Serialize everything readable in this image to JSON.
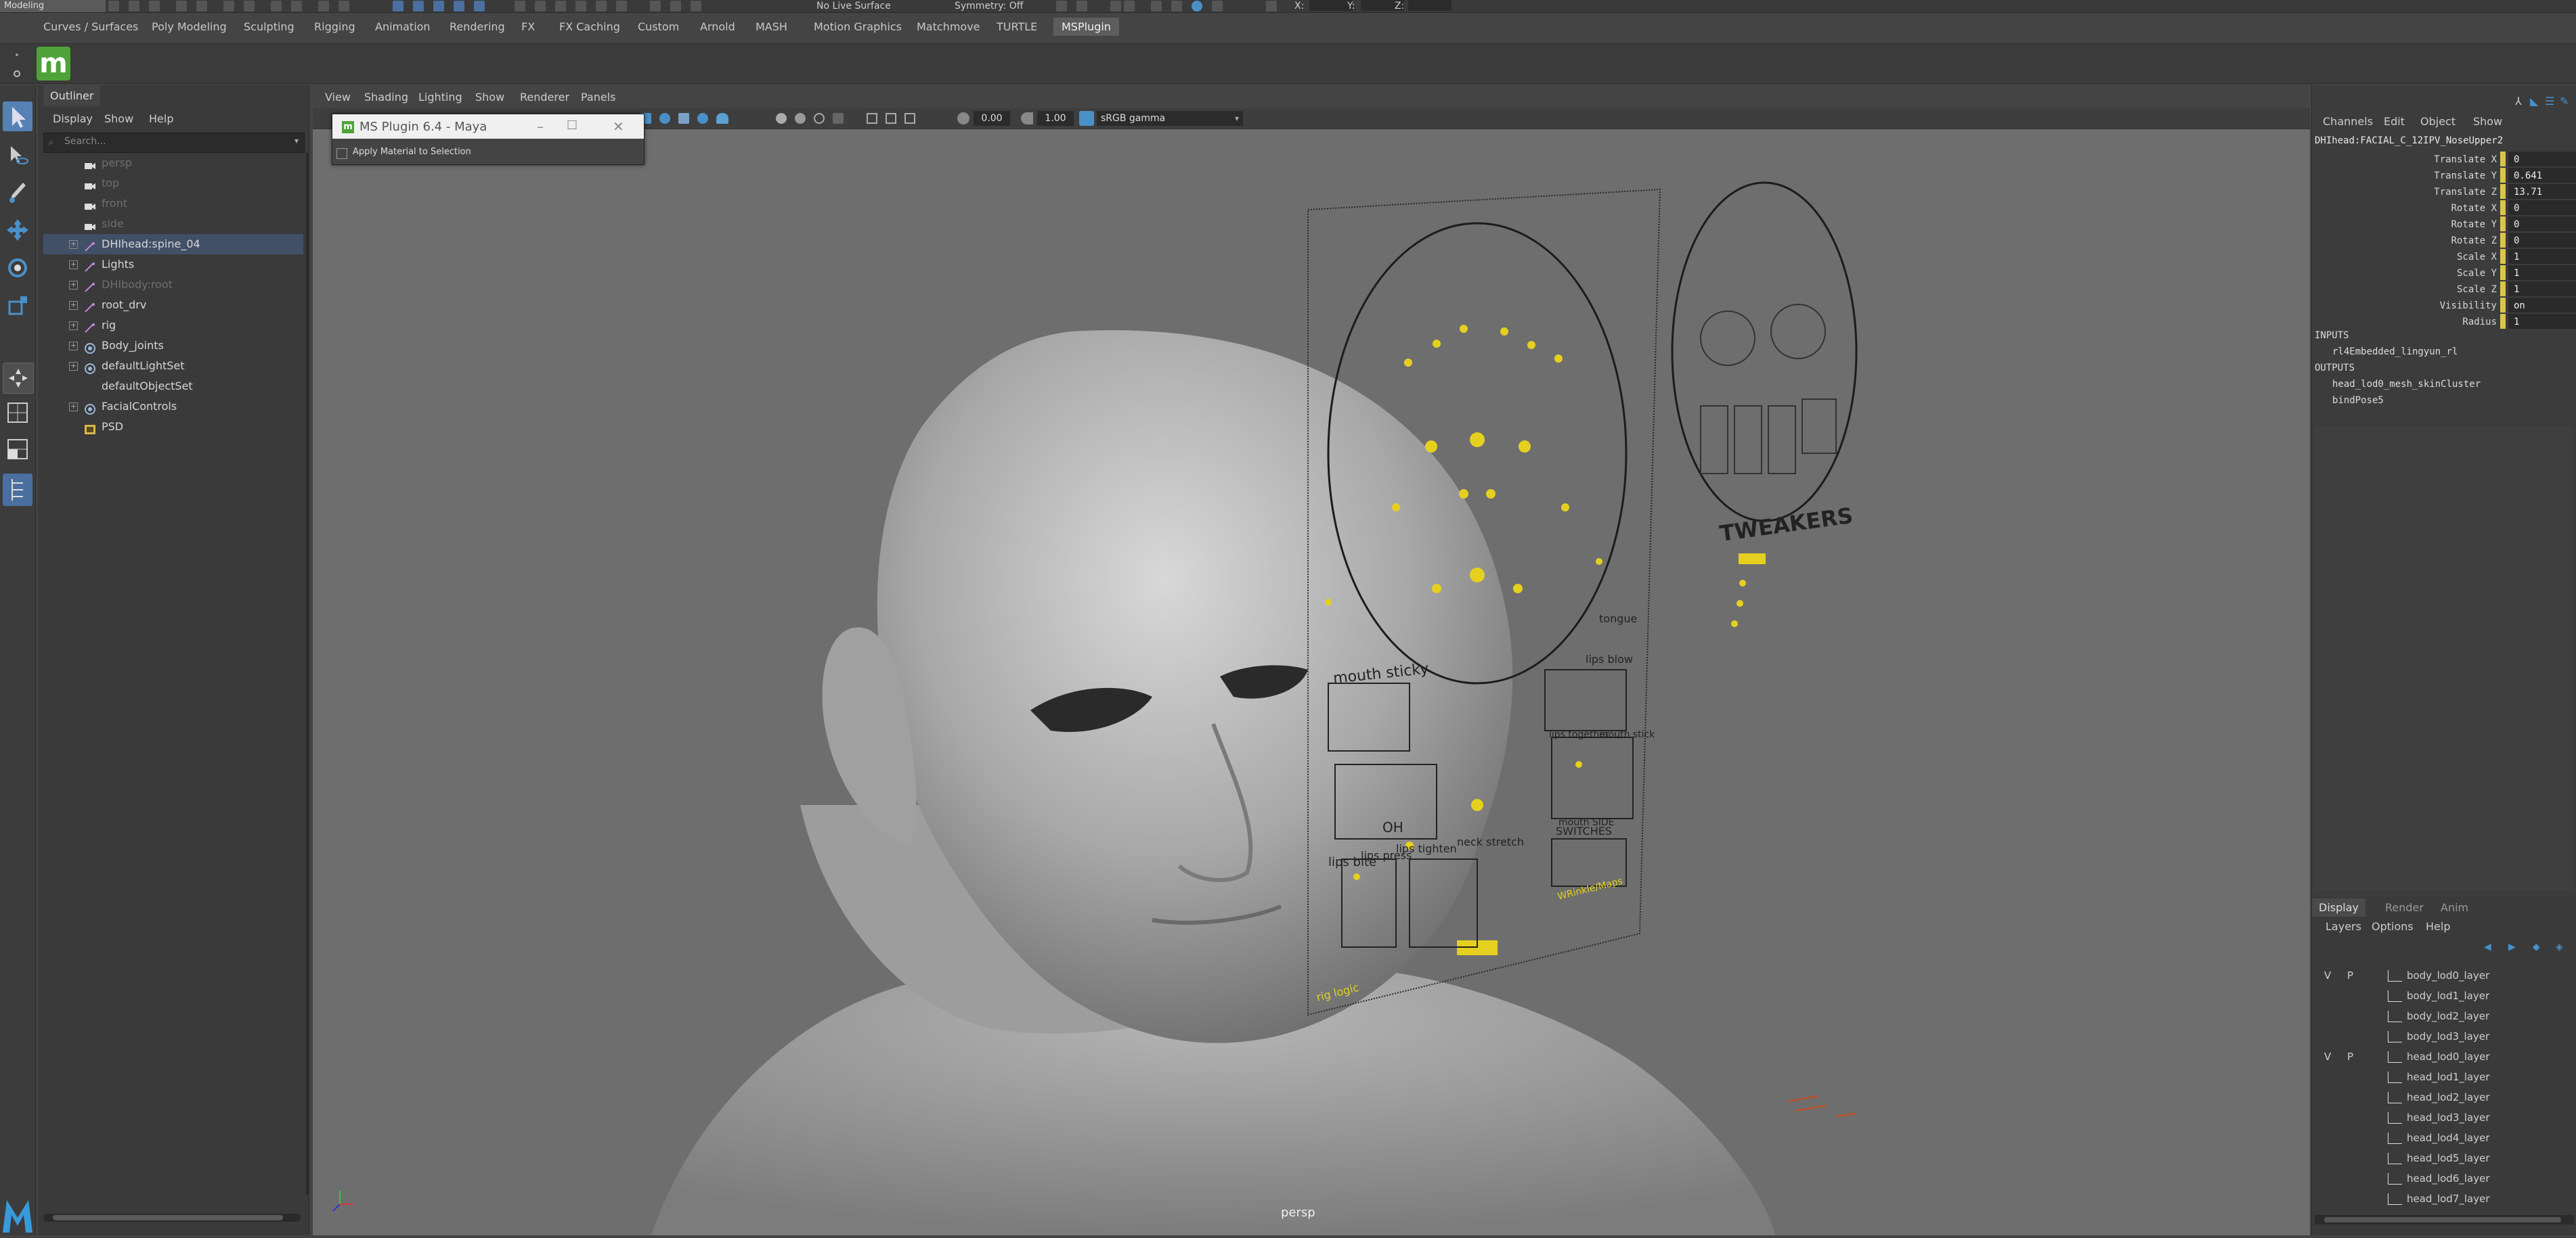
{
  "top_strip": {
    "mode": "Modeling",
    "live_surface": "No Live Surface",
    "symmetry": "Symmetry: Off",
    "coord_labels": [
      "X:",
      "Y:",
      "Z:"
    ]
  },
  "shelf_tabs": [
    "Curves / Surfaces",
    "Poly Modeling",
    "Sculpting",
    "Rigging",
    "Animation",
    "Rendering",
    "FX",
    "FX Caching",
    "Custom",
    "Arnold",
    "MASH",
    "Motion Graphics",
    "Matchmove",
    "TURTLE",
    "MSPlugin"
  ],
  "shelf": {
    "logo": "m"
  },
  "outliner": {
    "tab": "Outliner",
    "menus": [
      "Display",
      "Show",
      "Help"
    ],
    "search_placeholder": "Search...",
    "items": [
      {
        "label": "persp",
        "dim": true,
        "kind": "camera",
        "expand": false
      },
      {
        "label": "top",
        "dim": true,
        "kind": "camera",
        "expand": false
      },
      {
        "label": "front",
        "dim": true,
        "kind": "camera",
        "expand": false
      },
      {
        "label": "side",
        "dim": true,
        "kind": "camera",
        "expand": false
      },
      {
        "label": "DHIhead:spine_04",
        "dim": false,
        "kind": "joint",
        "expand": true,
        "selected": true
      },
      {
        "label": "Lights",
        "dim": false,
        "kind": "transform",
        "expand": true
      },
      {
        "label": "DHIbody:root",
        "dim": true,
        "kind": "joint",
        "expand": true
      },
      {
        "label": "root_drv",
        "dim": false,
        "kind": "joint",
        "expand": true
      },
      {
        "label": "rig",
        "dim": false,
        "kind": "joint",
        "expand": true
      },
      {
        "label": "Body_joints",
        "dim": false,
        "kind": "set",
        "expand": true
      },
      {
        "label": "defaultLightSet",
        "dim": false,
        "kind": "set",
        "expand": true
      },
      {
        "label": "defaultObjectSet",
        "dim": false,
        "kind": "set",
        "expand": false
      },
      {
        "label": "FacialControls",
        "dim": false,
        "kind": "set",
        "expand": true
      },
      {
        "label": "PSD",
        "dim": false,
        "kind": "psd",
        "expand": false
      }
    ]
  },
  "viewport": {
    "menus": [
      "View",
      "Shading",
      "Lighting",
      "Show",
      "Renderer",
      "Panels"
    ],
    "exposure": "0.00",
    "gamma": "1.00",
    "color_space": "sRGB gamma",
    "camera_label": "persp"
  },
  "plugin_window": {
    "title": "MS Plugin 6.4 - Maya",
    "checkbox_label": "Apply Material to Selection"
  },
  "rig_board": {
    "sections": [
      "mouth sticky",
      "tongue",
      "lips blow",
      "lips together",
      "mouth stick",
      "mouth SIDE",
      "OH",
      "neck stretch",
      "lips bite",
      "lips press",
      "lips tighten",
      "SWITCHES",
      "rig logic",
      "WRinkle/Maps"
    ],
    "tweakers_title": "TWEAKERS"
  },
  "channel_box": {
    "menus": [
      "Channels",
      "Edit",
      "Object",
      "Show"
    ],
    "node_name": "DHIhead:FACIAL_C_12IPV_NoseUpper2",
    "channels": [
      {
        "name": "Translate X",
        "value": "0"
      },
      {
        "name": "Translate Y",
        "value": "0.641"
      },
      {
        "name": "Translate Z",
        "value": "13.71"
      },
      {
        "name": "Rotate X",
        "value": "0"
      },
      {
        "name": "Rotate Y",
        "value": "0"
      },
      {
        "name": "Rotate Z",
        "value": "0"
      },
      {
        "name": "Scale X",
        "value": "1"
      },
      {
        "name": "Scale Y",
        "value": "1"
      },
      {
        "name": "Scale Z",
        "value": "1"
      },
      {
        "name": "Visibility",
        "value": "on"
      },
      {
        "name": "Radius",
        "value": "1"
      }
    ],
    "inputs_label": "INPUTS",
    "inputs": [
      "rl4Embedded_lingyun_rl"
    ],
    "outputs_label": "OUTPUTS",
    "outputs": [
      "head_lod0_mesh_skinCluster",
      "bindPose5"
    ]
  },
  "layer_editor": {
    "tabs": [
      "Display",
      "Render",
      "Anim"
    ],
    "menus": [
      "Layers",
      "Options",
      "Help"
    ],
    "layers": [
      {
        "v": "V",
        "p": "P",
        "name": "body_lod0_layer"
      },
      {
        "v": "",
        "p": "",
        "name": "body_lod1_layer"
      },
      {
        "v": "",
        "p": "",
        "name": "body_lod2_layer"
      },
      {
        "v": "",
        "p": "",
        "name": "body_lod3_layer"
      },
      {
        "v": "V",
        "p": "P",
        "name": "head_lod0_layer"
      },
      {
        "v": "",
        "p": "",
        "name": "head_lod1_layer"
      },
      {
        "v": "",
        "p": "",
        "name": "head_lod2_layer"
      },
      {
        "v": "",
        "p": "",
        "name": "head_lod3_layer"
      },
      {
        "v": "",
        "p": "",
        "name": "head_lod4_layer"
      },
      {
        "v": "",
        "p": "",
        "name": "head_lod5_layer"
      },
      {
        "v": "",
        "p": "",
        "name": "head_lod6_layer"
      },
      {
        "v": "",
        "p": "",
        "name": "head_lod7_layer"
      }
    ]
  },
  "colors": {
    "accent_blue": "#4a90c8",
    "selection": "#415067",
    "rig_yellow": "#e5d020",
    "maya_green": "#4fa23a"
  }
}
